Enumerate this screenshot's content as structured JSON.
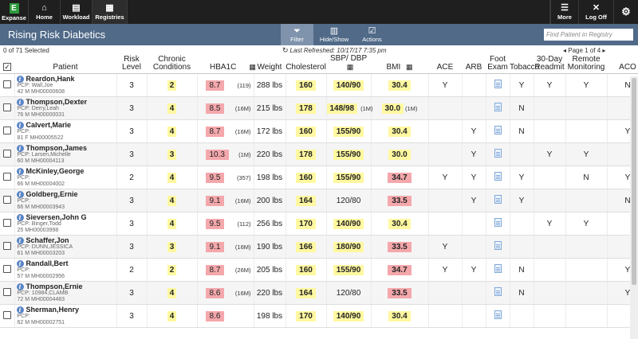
{
  "nav": {
    "brand": "Expanse",
    "brand_letter": "E",
    "home": "Home",
    "workload": "Workload",
    "registries": "Registries",
    "more": "More",
    "logoff": "Log Off"
  },
  "titlebar": {
    "title": "Rising Risk Diabetics",
    "filter": "Filter",
    "hideshow": "Hide/Show",
    "actions": "Actions",
    "search_placeholder": "Find Patient in Registry"
  },
  "info": {
    "selected": "0 of 71 Selected",
    "refreshed": "Last Refreshed: 10/17/17 7:35 pm",
    "page": "Page 1 of 4"
  },
  "columns": {
    "patient": "Patient",
    "risk1": "Risk",
    "risk2": "Level",
    "chronic1": "Chronic",
    "chronic2": "Conditions",
    "hba1c": "HBA1C",
    "weight": "Weight",
    "cholesterol": "Cholesterol",
    "sbp": "SBP/ DBP",
    "bmi": "BMI",
    "ace": "ACE",
    "arb": "ARB",
    "foot1": "Foot",
    "foot2": "Exam",
    "tobacco": "Tobacco",
    "readmit1": "30-Day",
    "readmit2": "Readmit",
    "remote1": "Remote",
    "remote2": "Monitoring",
    "aco": "ACO"
  },
  "rows": [
    {
      "name": "Reardon,Hank",
      "pcp": "PCP: Wall,Joe",
      "demo": "42  M  MH00000608",
      "risk": "3",
      "chronic": "2",
      "hba1c": "8.7",
      "hba1c_count": "(119)",
      "weight": "288 lbs",
      "chol": "160",
      "sbp": "140/90",
      "sbp_count": "",
      "bmi": "30.4",
      "bmi_high": false,
      "ace": "Y",
      "arb": "",
      "tobacco": "Y",
      "readmit": "Y",
      "remote": "Y",
      "aco": "N"
    },
    {
      "name": "Thompson,Dexter",
      "pcp": "PCP: Derry,Leah",
      "demo": "76  M  MH00000031",
      "risk": "3",
      "chronic": "4",
      "hba1c": "8.5",
      "hba1c_count": "(16M)",
      "weight": "215 lbs",
      "chol": "178",
      "sbp": "148/98",
      "sbp_count": "(1M)",
      "bmi": "30.0",
      "bmi_count": "(1M)",
      "bmi_high": false,
      "ace": "",
      "arb": "",
      "tobacco": "N",
      "readmit": "",
      "remote": "",
      "aco": ""
    },
    {
      "name": "Calvert,Marie",
      "pcp": "PCP:",
      "demo": "81  F  MH00005522",
      "risk": "3",
      "chronic": "4",
      "hba1c": "8.7",
      "hba1c_count": "(16M)",
      "weight": "172 lbs",
      "chol": "160",
      "sbp": "155/90",
      "sbp_count": "",
      "bmi": "30.4",
      "bmi_high": false,
      "ace": "",
      "arb": "Y",
      "tobacco": "N",
      "readmit": "",
      "remote": "",
      "aco": "Y"
    },
    {
      "name": "Thompson,James",
      "pcp": "PCP: Larsen,Michelle",
      "demo": "60  M  MH00004113",
      "risk": "3",
      "chronic": "3",
      "hba1c": "10.3",
      "hba1c_count": "(1M)",
      "weight": "220 lbs",
      "chol": "178",
      "sbp": "155/90",
      "sbp_count": "",
      "bmi": "30.0",
      "bmi_high": false,
      "ace": "",
      "arb": "Y",
      "tobacco": "",
      "readmit": "Y",
      "remote": "Y",
      "aco": ""
    },
    {
      "name": "McKinley,George",
      "pcp": "PCP:",
      "demo": "66  M  MH00004002",
      "risk": "2",
      "chronic": "4",
      "hba1c": "9.5",
      "hba1c_count": "(357)",
      "weight": "198 lbs",
      "chol": "160",
      "sbp": "155/90",
      "sbp_count": "",
      "bmi": "34.7",
      "bmi_high": true,
      "ace": "Y",
      "arb": "Y",
      "tobacco": "Y",
      "readmit": "",
      "remote": "N",
      "aco": "Y"
    },
    {
      "name": "Goldberg,Ernie",
      "pcp": "PCP:",
      "demo": "66  M  MH00003943",
      "risk": "3",
      "chronic": "4",
      "hba1c": "9.1",
      "hba1c_count": "(16M)",
      "weight": "200 lbs",
      "chol": "164",
      "sbp": "120/80",
      "sbp_count": "",
      "bmi": "33.5",
      "bmi_high": true,
      "ace": "",
      "arb": "Y",
      "tobacco": "Y",
      "readmit": "",
      "remote": "",
      "aco": "N"
    },
    {
      "name": "Sieversen,John G",
      "pcp": "PCP: Binger,Todd",
      "demo": "25      MH00003998",
      "risk": "3",
      "chronic": "4",
      "hba1c": "9.5",
      "hba1c_count": "(112)",
      "weight": "256 lbs",
      "chol": "170",
      "sbp": "140/90",
      "sbp_count": "",
      "bmi": "30.4",
      "bmi_high": false,
      "ace": "",
      "arb": "",
      "tobacco": "",
      "readmit": "Y",
      "remote": "Y",
      "aco": ""
    },
    {
      "name": "Schaffer,Jon",
      "pcp": "PCP: DUNN,JESSICA",
      "demo": "61  M  MH00003203",
      "risk": "3",
      "chronic": "3",
      "hba1c": "9.1",
      "hba1c_count": "(16M)",
      "weight": "190 lbs",
      "chol": "166",
      "sbp": "180/90",
      "sbp_count": "",
      "bmi": "33.5",
      "bmi_high": true,
      "ace": "Y",
      "arb": "",
      "tobacco": "",
      "readmit": "",
      "remote": "",
      "aco": ""
    },
    {
      "name": "Randall,Bert",
      "pcp": "PCP:",
      "demo": "57  M  MH00002956",
      "risk": "2",
      "chronic": "2",
      "hba1c": "8.7",
      "hba1c_count": "(26M)",
      "weight": "205 lbs",
      "chol": "160",
      "sbp": "155/90",
      "sbp_count": "",
      "bmi": "34.7",
      "bmi_high": true,
      "ace": "Y",
      "arb": "Y",
      "tobacco": "N",
      "readmit": "",
      "remote": "",
      "aco": "Y"
    },
    {
      "name": "Thompson,Ernie",
      "pcp": "PCP: 10984,CLAMB",
      "demo": "72  M  MH00004483",
      "risk": "3",
      "chronic": "4",
      "hba1c": "8.6",
      "hba1c_count": "(16M)",
      "weight": "220 lbs",
      "chol": "164",
      "sbp": "120/80",
      "sbp_count": "",
      "bmi": "33.5",
      "bmi_high": true,
      "ace": "",
      "arb": "",
      "tobacco": "N",
      "readmit": "",
      "remote": "",
      "aco": "Y"
    },
    {
      "name": "Sherman,Henry",
      "pcp": "PCP:",
      "demo": "62  M  MH00002751",
      "risk": "3",
      "chronic": "4",
      "hba1c": "8.6",
      "hba1c_count": "",
      "weight": "198 lbs",
      "chol": "170",
      "sbp": "140/90",
      "sbp_count": "",
      "bmi": "30.4",
      "bmi_high": false,
      "ace": "",
      "arb": "",
      "tobacco": "",
      "readmit": "",
      "remote": "",
      "aco": ""
    }
  ]
}
